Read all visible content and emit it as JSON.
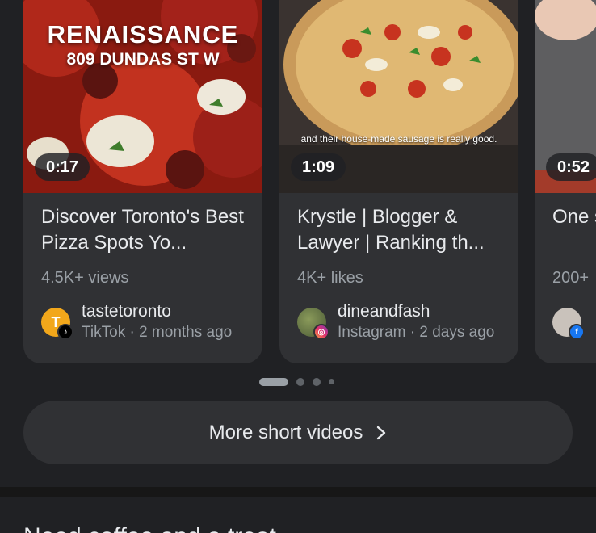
{
  "cards": [
    {
      "thumb_title_line1": "RENAISSANCE",
      "thumb_title_line2": "809 DUNDAS ST W",
      "duration": "0:17",
      "title": "Discover Toronto's Best Pizza Spots Yo...",
      "stats": "4.5K+ views",
      "author": "tastetoronto",
      "meta": "TikTok · 2 months ago",
      "avatar_letter": "T",
      "badge_icon": "tiktok-icon"
    },
    {
      "caption": "and their house-made sausage is really good.",
      "duration": "1:09",
      "title": "Krystle | Blogger & Lawyer | Ranking th...",
      "stats": "4K+ likes",
      "author": "dineandfash",
      "meta": "Instagram · 2 days ago",
      "badge_icon": "instagram-icon"
    },
    {
      "duration": "0:52",
      "title": "One spot",
      "stats": "200+",
      "badge_icon": "facebook-icon"
    }
  ],
  "more_button": {
    "label": "More short videos"
  },
  "next_section": {
    "title": "Need coffee and a treat..."
  },
  "colors": {
    "background": "#202124",
    "card": "#303134",
    "secondary_text": "#9aa0a6"
  }
}
